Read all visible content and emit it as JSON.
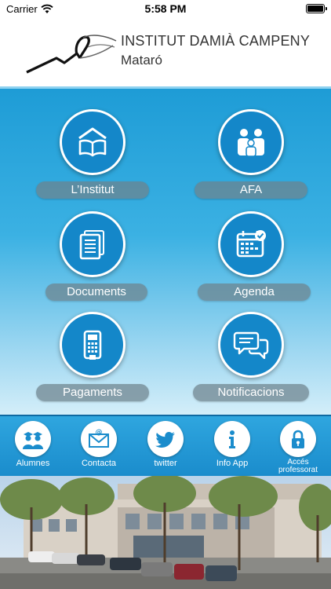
{
  "status_bar": {
    "carrier": "Carrier",
    "time": "5:58 PM"
  },
  "header": {
    "title": "INSTITUT  DAMIÀ CAMPENY",
    "subtitle": "Mataró"
  },
  "menu": [
    {
      "label": "L’Institut",
      "icon": "book-house-icon"
    },
    {
      "label": "AFA",
      "icon": "family-icon"
    },
    {
      "label": "Documents",
      "icon": "documents-icon"
    },
    {
      "label": "Agenda",
      "icon": "calendar-icon"
    },
    {
      "label": "Pagaments",
      "icon": "card-terminal-icon"
    },
    {
      "label": "Notificacions",
      "icon": "chat-bubbles-icon"
    }
  ],
  "toolbar": [
    {
      "label": "Alumnes",
      "icon": "students-icon"
    },
    {
      "label": "Contacta",
      "icon": "mail-icon"
    },
    {
      "label": "twitter",
      "icon": "twitter-icon"
    },
    {
      "label": "Info App",
      "icon": "info-icon"
    },
    {
      "label": "Accés professorat",
      "icon": "lock-icon"
    }
  ],
  "colors": {
    "accent": "#1487c9",
    "toolbar": "#1a8ccc",
    "label_pill": "#6e828c"
  }
}
